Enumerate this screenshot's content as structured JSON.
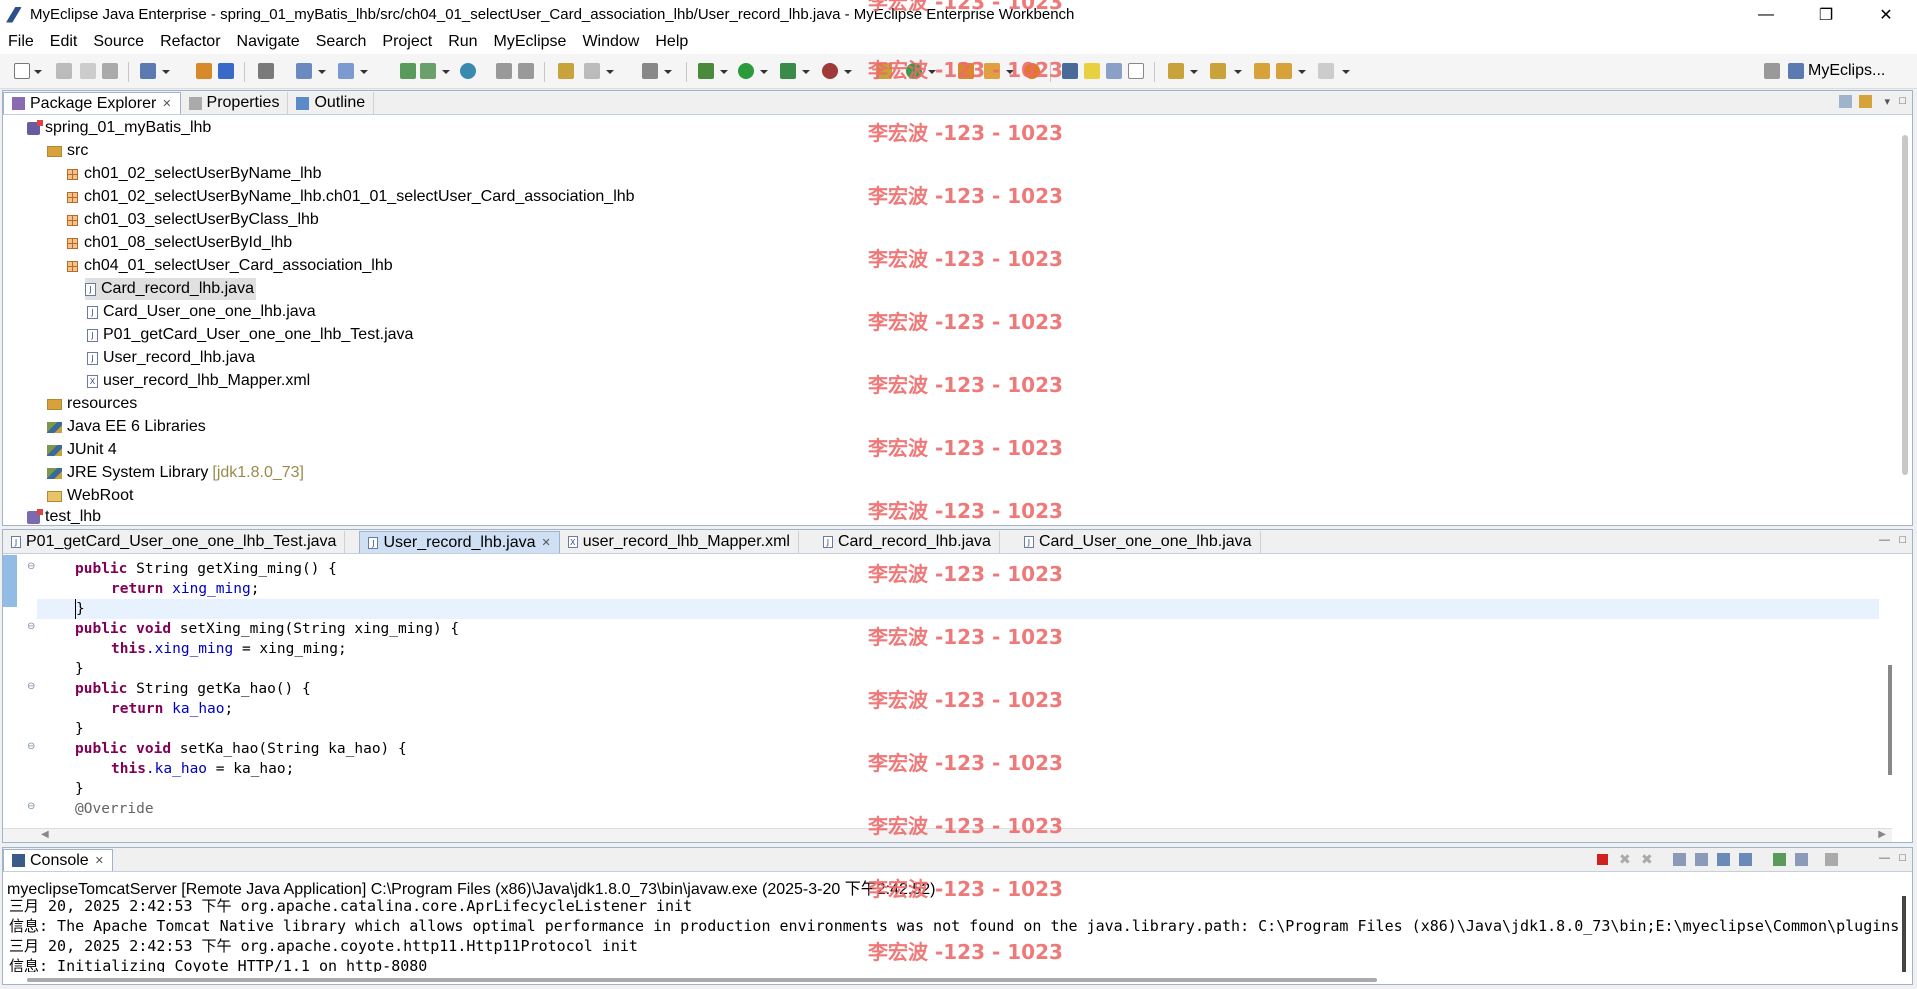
{
  "window": {
    "title": "MyEclipse Java Enterprise - spring_01_myBatis_lhb/src/ch04_01_selectUser_Card_association_lhb/User_record_lhb.java - MyEclipse Enterprise Workbench",
    "minimize": "—",
    "restore": "❐",
    "close": "✕"
  },
  "menu": [
    "File",
    "Edit",
    "Source",
    "Refactor",
    "Navigate",
    "Search",
    "Project",
    "Run",
    "MyEclipse",
    "Window",
    "Help"
  ],
  "perspective": {
    "label": "MyEclips..."
  },
  "explorer": {
    "tabs": [
      {
        "label": "Package Explorer",
        "close": "✕"
      },
      {
        "label": "Properties"
      },
      {
        "label": "Outline"
      }
    ],
    "tree": {
      "project": "spring_01_myBatis_lhb",
      "src": "src",
      "pkg1": "ch01_02_selectUserByName_lhb",
      "pkg2": "ch01_02_selectUserByName_lhb.ch01_01_selectUser_Card_association_lhb",
      "pkg3": "ch01_03_selectUserByClass_lhb",
      "pkg4": "ch01_08_selectUserById_lhb",
      "pkg5": "ch04_01_selectUser_Card_association_lhb",
      "file1": "Card_record_lhb.java",
      "file2": "Card_User_one_one_lhb.java",
      "file3": "P01_getCard_User_one_one_lhb_Test.java",
      "file4": "User_record_lhb.java",
      "file5": "user_record_lhb_Mapper.xml",
      "resources": "resources",
      "lib1": "Java EE 6 Libraries",
      "lib2": "JUnit 4",
      "lib3": "JRE System Library",
      "lib3_suffix": "[jdk1.8.0_73]",
      "webroot": "WebRoot",
      "project2": "test_lhb"
    }
  },
  "editor": {
    "tabs": [
      {
        "label": "P01_getCard_User_one_one_lhb_Test.java"
      },
      {
        "label": "User_record_lhb.java",
        "close": "✕"
      },
      {
        "label": "user_record_lhb_Mapper.xml"
      },
      {
        "label": "Card_record_lhb.java"
      },
      {
        "label": "Card_User_one_one_lhb.java"
      }
    ],
    "code": {
      "l1_kw": "public",
      "l1_rest": " String getXing_ming() {",
      "l2_kw": "return",
      "l2_fld": "xing_ming",
      "l2_rest": ";",
      "l3": "}",
      "l4_kw1": "public",
      "l4_kw2": "void",
      "l4_rest": " setXing_ming(String xing_ming) {",
      "l5_kw": "this",
      "l5_fld": ".xing_ming",
      "l5_rest": " = xing_ming;",
      "l6": "}",
      "l7_kw": "public",
      "l7_rest": " String getKa_hao() {",
      "l8_kw": "return",
      "l8_fld": "ka_hao",
      "l8_rest": ";",
      "l9": "}",
      "l10_kw1": "public",
      "l10_kw2": "void",
      "l10_rest": " setKa_hao(String ka_hao) {",
      "l11_kw": "this",
      "l11_fld": ".ka_hao",
      "l11_rest": " = ka_hao;",
      "l12": "}",
      "l13": "@Override"
    }
  },
  "console": {
    "tab": {
      "label": "Console",
      "close": "✕"
    },
    "header": "myeclipseTomcatServer [Remote Java Application] C:\\Program Files (x86)\\Java\\jdk1.8.0_73\\bin\\javaw.exe (2025-3-20 下午2:42:52)",
    "lines": [
      "三月 20, 2025 2:42:53 下午 org.apache.catalina.core.AprLifecycleListener init",
      "信息: The Apache Tomcat Native library which allows optimal performance in production environments was not found on the java.library.path: C:\\Program Files (x86)\\Java\\jdk1.8.0_73\\bin;E:\\myeclipse\\Common\\plugins",
      "三月 20, 2025 2:42:53 下午 org.apache.coyote.http11.Http11Protocol init",
      "信息: Initializing Coyote HTTP/1.1 on http-8080"
    ]
  },
  "watermark": "李宏波 -123 - 1023"
}
